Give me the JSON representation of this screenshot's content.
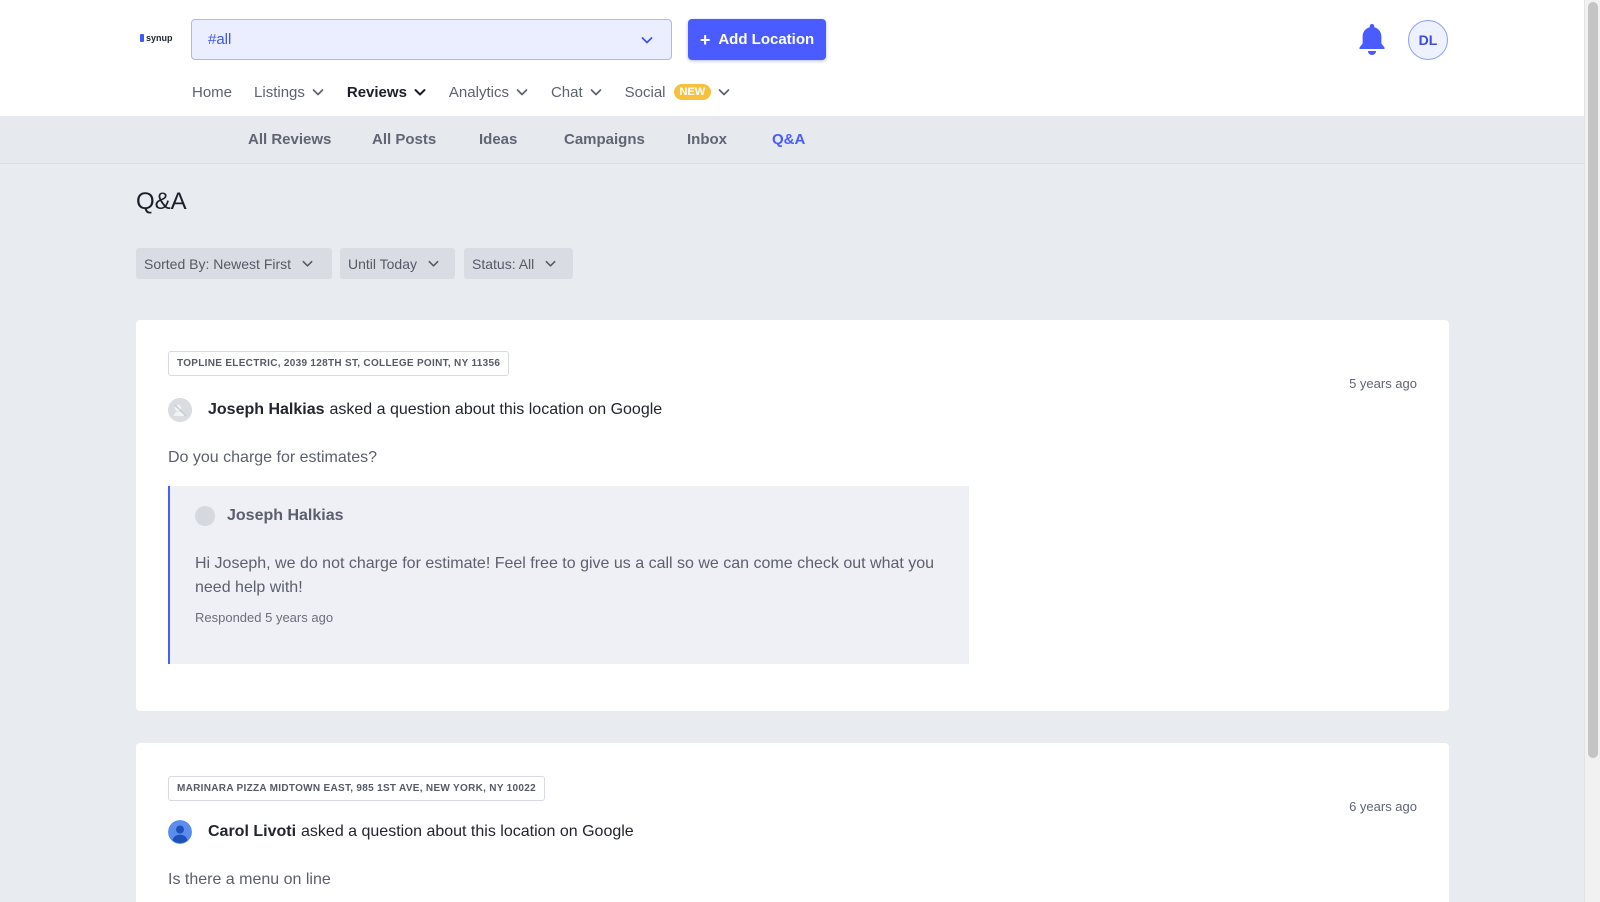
{
  "header": {
    "logo_text": "synup",
    "location_select": {
      "value": "#all"
    },
    "add_location_label": "Add Location",
    "avatar_initials": "DL"
  },
  "main_nav": [
    {
      "label": "Home",
      "has_dropdown": false,
      "active": false
    },
    {
      "label": "Listings",
      "has_dropdown": true,
      "active": false
    },
    {
      "label": "Reviews",
      "has_dropdown": true,
      "active": true
    },
    {
      "label": "Analytics",
      "has_dropdown": true,
      "active": false
    },
    {
      "label": "Chat",
      "has_dropdown": true,
      "active": false
    },
    {
      "label": "Social",
      "has_dropdown": true,
      "active": false,
      "badge": "NEW"
    }
  ],
  "sub_nav": [
    {
      "label": "All Reviews",
      "active": false
    },
    {
      "label": "All Posts",
      "active": false
    },
    {
      "label": "Ideas",
      "active": false
    },
    {
      "label": "Campaigns",
      "active": false
    },
    {
      "label": "Inbox",
      "active": false
    },
    {
      "label": "Q&A",
      "active": true
    }
  ],
  "page": {
    "title": "Q&A"
  },
  "filters": [
    {
      "label": "Sorted By: Newest First"
    },
    {
      "label": "Until Today"
    },
    {
      "label": "Status: All"
    }
  ],
  "questions": [
    {
      "location": "TOPLINE ELECTRIC, 2039 128TH ST, COLLEGE POINT, NY 11356",
      "time": "5 years ago",
      "asker": "Joseph Halkias",
      "action_text": "asked a question about this location on Google",
      "question": "Do you charge for estimates?",
      "answer": {
        "author": "Joseph Halkias",
        "text": "Hi Joseph, we do not charge for estimate! Feel free to give us a call so we can come check out what you need help with!",
        "responded": "Responded 5 years ago"
      }
    },
    {
      "location": "MARINARA PIZZA MIDTOWN EAST, 985 1ST AVE, NEW YORK, NY 10022",
      "time": "6 years ago",
      "asker": "Carol Livoti",
      "action_text": "asked a question about this location on Google",
      "question": "Is there a menu on line"
    }
  ],
  "colors": {
    "accent": "#4a5cff",
    "badge": "#f6c23e",
    "page_bg": "#e8ebef",
    "card_bg": "#ffffff"
  }
}
